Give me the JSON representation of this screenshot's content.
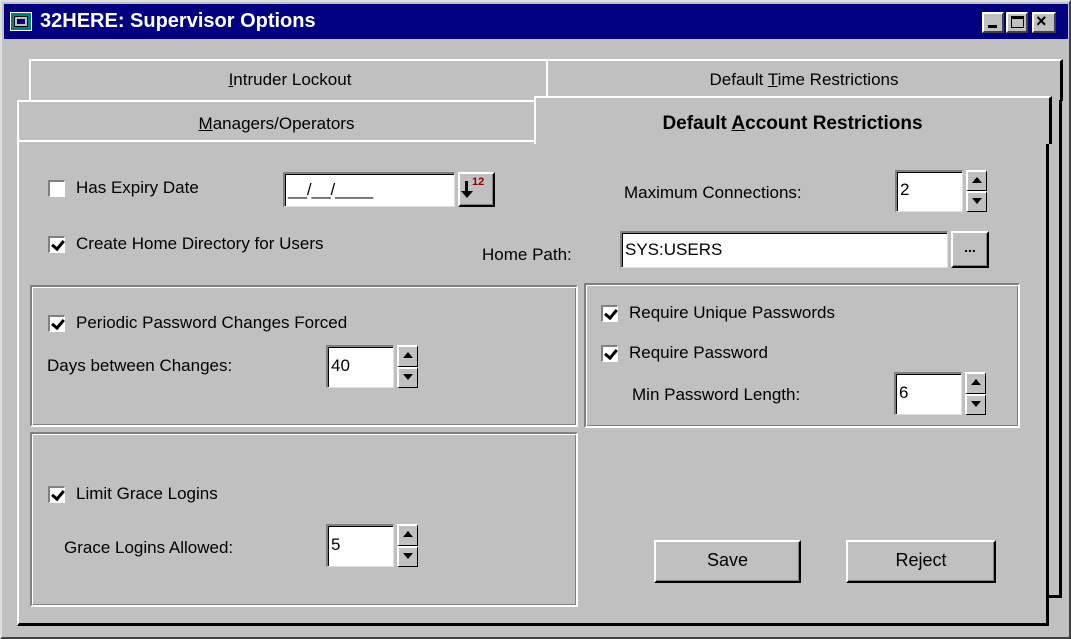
{
  "window": {
    "title": "32HERE: Supervisor Options",
    "controls": {
      "minimize": "_",
      "close": "×"
    }
  },
  "tabs": {
    "back_row": [
      {
        "pre": "",
        "ul": "I",
        "post": "ntruder Lockout"
      },
      {
        "pre": "Default ",
        "ul": "T",
        "post": "ime Restrictions"
      }
    ],
    "front_row": [
      {
        "pre": "",
        "ul": "M",
        "post": "anagers/Operators"
      },
      {
        "pre": "Default ",
        "ul": "A",
        "post": "ccount Restrictions"
      }
    ],
    "active": "Default Account Restrictions"
  },
  "account": {
    "has_expiry": {
      "label": "Has Expiry Date",
      "checked": false
    },
    "expiry_date": {
      "value": "__/__/____"
    },
    "calendar_icon_text": "12",
    "max_connections": {
      "label": "Maximum Connections:",
      "value": "2"
    },
    "create_home": {
      "label": "Create Home Directory for Users",
      "checked": true
    },
    "home_path": {
      "label": "Home Path:",
      "value": "SYS:USERS",
      "browse_label": "..."
    }
  },
  "password_changes": {
    "periodic": {
      "label": "Periodic Password Changes Forced",
      "checked": true
    },
    "days": {
      "label": "Days between Changes:",
      "value": "40"
    }
  },
  "passwords": {
    "unique": {
      "label": "Require Unique Passwords",
      "checked": true
    },
    "required": {
      "label": "Require Password",
      "checked": true
    },
    "min_length": {
      "label": "Min Password Length:",
      "value": "6"
    }
  },
  "grace": {
    "limit": {
      "label": "Limit Grace Logins",
      "checked": true
    },
    "allowed": {
      "label": "Grace Logins Allowed:",
      "value": "5"
    }
  },
  "buttons": {
    "save": "Save",
    "reject": "Reject"
  }
}
